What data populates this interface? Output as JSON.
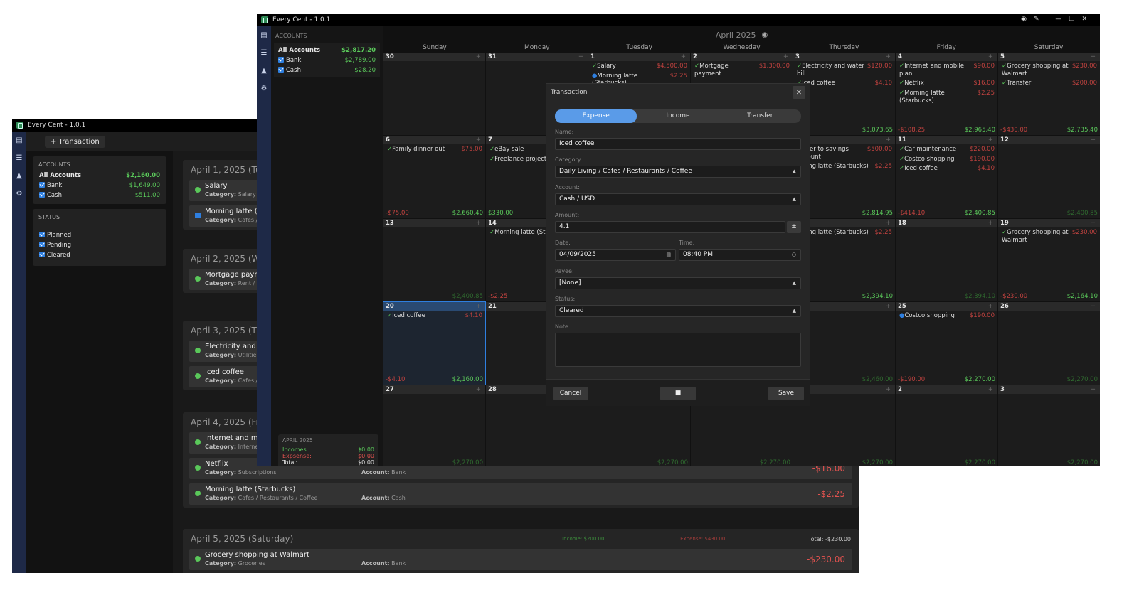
{
  "back": {
    "title": "Every Cent - 1.0.1",
    "add_button": "+ Transaction",
    "accounts": {
      "heading": "ACCOUNTS",
      "items": [
        {
          "name": "All Accounts",
          "amount": "$2,160.00"
        },
        {
          "name": "Bank",
          "amount": "$1,649.00"
        },
        {
          "name": "Cash",
          "amount": "$511.00"
        }
      ]
    },
    "status": {
      "heading": "STATUS",
      "items": [
        "Planned",
        "Pending",
        "Cleared"
      ]
    },
    "days": [
      {
        "date": "April 1, 2025 (Tuesda",
        "tx": [
          {
            "name": "Salary",
            "cat": "Salary",
            "status": "cleared"
          },
          {
            "name": "Morning latte (Starl",
            "cat": "Cafes / Resta",
            "status": "planned"
          }
        ]
      },
      {
        "date": "April 2, 2025 (Wedne",
        "tx": [
          {
            "name": "Mortgage payment",
            "cat": "Rent / Mortg",
            "status": "cleared"
          }
        ]
      },
      {
        "date": "April 3, 2025 (Thursd",
        "tx": [
          {
            "name": "Electricity and wate",
            "cat": "Utilities",
            "status": "cleared"
          },
          {
            "name": "Iced coffee",
            "cat": "Cafes / Resta",
            "status": "cleared"
          }
        ]
      },
      {
        "date": "April 4, 2025 (Friday)",
        "tx": [
          {
            "name": "Internet and mobile",
            "cat": "Internet",
            "status": "cleared"
          },
          {
            "name": "Netflix",
            "cat": "Subscriptions",
            "account": "Bank",
            "amount": "-$16.00",
            "status": "cleared"
          },
          {
            "name": "Morning latte (Starbucks)",
            "cat": "Cafes / Restaurants / Coffee",
            "account": "Cash",
            "amount": "-$2.25",
            "status": "cleared"
          }
        ]
      },
      {
        "date": "April 5, 2025 (Saturday)",
        "income": "$200.00",
        "expense": "$430.00",
        "total": "-$230.00",
        "tx": [
          {
            "name": "Grocery shopping at Walmart",
            "cat": "Groceries",
            "account": "Bank",
            "amount": "-$230.00",
            "status": "cleared"
          }
        ]
      }
    ],
    "labels": {
      "category": "Category:",
      "account": "Account:",
      "income": "Income:",
      "expense": "Expense:",
      "total": "Total:"
    }
  },
  "front": {
    "title": "Every Cent - 1.0.1",
    "month": "April 2025",
    "accounts": {
      "heading": "ACCOUNTS",
      "items": [
        {
          "name": "All Accounts",
          "amount": "$2,817.20"
        },
        {
          "name": "Bank",
          "amount": "$2,789.00"
        },
        {
          "name": "Cash",
          "amount": "$28.20"
        }
      ]
    },
    "summary": {
      "heading": "APRIL 2025",
      "incomes_label": "Incomes:",
      "incomes": "$0.00",
      "expenses_label": "Expsense:",
      "expenses": "$0.00",
      "total_label": "Total:",
      "total": "$0.00"
    },
    "weekdays": [
      "Sunday",
      "Monday",
      "Tuesday",
      "Wednesday",
      "Thursday",
      "Friday",
      "Saturday"
    ],
    "weeks": [
      [
        {
          "d": "30",
          "f": [
            "",
            ""
          ]
        },
        {
          "d": "31",
          "f": [
            "",
            ""
          ]
        },
        {
          "d": "1",
          "ev": [
            [
              "Salary",
              "$4,500.00",
              "c"
            ],
            [
              "Morning latte (Starbucks)",
              "$2.25",
              "p"
            ]
          ],
          "f": [
            "",
            ""
          ]
        },
        {
          "d": "2",
          "ev": [
            [
              "Mortgage payment",
              "$1,300.00",
              "c"
            ]
          ],
          "f": [
            "",
            ""
          ]
        },
        {
          "d": "3",
          "ev": [
            [
              "Electricity and water bill",
              "$120.00",
              "c"
            ],
            [
              "Iced coffee",
              "$4.10",
              "c"
            ]
          ],
          "f": [
            ".10",
            "$3,073.65"
          ]
        },
        {
          "d": "4",
          "ev": [
            [
              "Internet and mobile plan",
              "$90.00",
              "c"
            ],
            [
              "Netflix",
              "$16.00",
              "c"
            ],
            [
              "Morning latte (Starbucks)",
              "$2.25",
              "c"
            ]
          ],
          "f": [
            "-$108.25",
            "$2,965.40"
          ]
        },
        {
          "d": "5",
          "ev": [
            [
              "Grocery shopping at Walmart",
              "$230.00",
              "c"
            ],
            [
              "Transfer",
              "$200.00",
              "c"
            ]
          ],
          "f": [
            "-$430.00",
            "$2,735.40"
          ]
        }
      ],
      [
        {
          "d": "6",
          "ev": [
            [
              "Family dinner out",
              "$75.00",
              "c"
            ]
          ],
          "f": [
            "-$75.00",
            "$2,660.40"
          ]
        },
        {
          "d": "7",
          "ev": [
            [
              "eBay sale",
              "",
              ""
            ],
            [
              "Freelance project",
              "",
              ""
            ]
          ],
          "f": [
            "$330.00",
            ""
          ]
        },
        {
          "d": "",
          "f": [
            "",
            ""
          ]
        },
        {
          "d": "",
          "f": [
            "",
            ""
          ]
        },
        {
          "d": "",
          "ev": [
            [
              "ansfer to savings account",
              "$500.00",
              "x"
            ],
            [
              "orning latte (Starbucks)",
              "$2.25",
              "x"
            ]
          ],
          "f": [
            ".25",
            "$2,814.95"
          ]
        },
        {
          "d": "11",
          "ev": [
            [
              "Car maintenance",
              "$220.00",
              "c"
            ],
            [
              "Costco shopping",
              "$190.00",
              "c"
            ],
            [
              "Iced coffee",
              "$4.10",
              "c"
            ]
          ],
          "f": [
            "-$414.10",
            "$2,400.85"
          ]
        },
        {
          "d": "12",
          "f": [
            "",
            "$2,400.85"
          ]
        }
      ],
      [
        {
          "d": "13",
          "f": [
            "",
            "$2,400.85"
          ]
        },
        {
          "d": "14",
          "ev": [
            [
              "Morning latte (Sta",
              "",
              ""
            ]
          ],
          "f": [
            "-$2.25",
            ""
          ]
        },
        {
          "d": "",
          "f": [
            "",
            ""
          ]
        },
        {
          "d": "",
          "f": [
            "",
            ""
          ]
        },
        {
          "d": "",
          "ev": [
            [
              "orning latte (Starbucks)",
              "$2.25",
              "x"
            ]
          ],
          "f": [
            "",
            "$2,394.10"
          ]
        },
        {
          "d": "18",
          "f": [
            "",
            "$2,394.10"
          ]
        },
        {
          "d": "19",
          "ev": [
            [
              "Grocery shopping at Walmart",
              "$230.00",
              "c"
            ]
          ],
          "f": [
            "-$230.00",
            "$2,164.10"
          ]
        }
      ],
      [
        {
          "d": "20",
          "ev": [
            [
              "Iced coffee",
              "$4.10",
              "c"
            ]
          ],
          "f": [
            "-$4.10",
            "$2,160.00"
          ]
        },
        {
          "d": "21",
          "f": [
            "",
            ""
          ]
        },
        {
          "d": "",
          "f": [
            "",
            ""
          ]
        },
        {
          "d": "",
          "f": [
            "",
            ""
          ]
        },
        {
          "d": "",
          "f": [
            "",
            "$2,460.00"
          ]
        },
        {
          "d": "25",
          "ev": [
            [
              "Costco shopping",
              "$190.00",
              "p"
            ]
          ],
          "f": [
            "-$190.00",
            "$2,270.00"
          ]
        },
        {
          "d": "26",
          "f": [
            "",
            "$2,270.00"
          ]
        }
      ],
      [
        {
          "d": "27",
          "f": [
            "",
            "$2,270.00"
          ]
        },
        {
          "d": "28",
          "f": [
            "",
            ""
          ]
        },
        {
          "d": "",
          "f": [
            "",
            "$2,270.00"
          ]
        },
        {
          "d": "",
          "f": [
            "",
            "$2,270.00"
          ]
        },
        {
          "d": "",
          "f": [
            "",
            "$2,270.00"
          ]
        },
        {
          "d": "2",
          "f": [
            "",
            "$2,270.00"
          ]
        },
        {
          "d": "3",
          "f": [
            "",
            "$2,270.00"
          ]
        }
      ]
    ]
  },
  "dialog": {
    "title": "Transaction",
    "tabs": [
      "Expense",
      "Income",
      "Transfer"
    ],
    "name_label": "Name:",
    "name": "Iced coffee",
    "category_label": "Category:",
    "category": "Daily Living  /  Cafes / Restaurants / Coffee",
    "account_label": "Account:",
    "account": "Cash / USD",
    "amount_label": "Amount:",
    "amount": "4.1",
    "date_label": "Date:",
    "date": "04/09/2025",
    "time_label": "Time:",
    "time": "08:40 PM",
    "payee_label": "Payee:",
    "payee": "[None]",
    "status_label": "Status:",
    "status": "Cleared",
    "note_label": "Note:",
    "cancel": "Cancel",
    "save": "Save"
  },
  "colors": {
    "rail": "#1e2947",
    "accent": "#5a9be8",
    "positive": "#5ac85a",
    "negative": "#e0524f"
  }
}
